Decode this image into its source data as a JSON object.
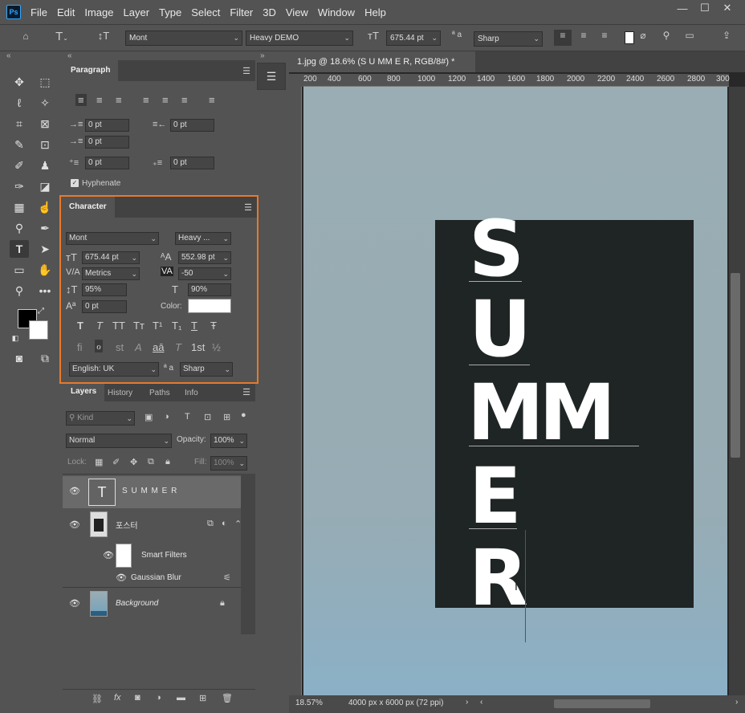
{
  "app": {
    "logo": "Ps"
  },
  "menu": [
    "File",
    "Edit",
    "Image",
    "Layer",
    "Type",
    "Select",
    "Filter",
    "3D",
    "View",
    "Window",
    "Help"
  ],
  "window_controls": [
    "—",
    "☐",
    "✕"
  ],
  "options": {
    "font_family": "Mont",
    "font_style": "Heavy DEMO",
    "font_size": "675.44 pt",
    "antialias_icon": "ª a",
    "antialias": "Sharp"
  },
  "paragraph": {
    "tab": "Paragraph",
    "indent_left": "0 pt",
    "indent_right": "0 pt",
    "indent_first": "0 pt",
    "space_before": "0 pt",
    "space_after": "0 pt",
    "hyphenate": "Hyphenate"
  },
  "character": {
    "tab": "Character",
    "font_family": "Mont",
    "font_style": "Heavy ...",
    "size": "675.44 pt",
    "leading": "552.98 pt",
    "kerning": "Metrics",
    "tracking": "-50",
    "vscale": "95%",
    "hscale": "90%",
    "baseline": "0 pt",
    "color_label": "Color:",
    "language": "English: UK",
    "aa_label": "ª a",
    "antialias": "Sharp",
    "styles": [
      "T",
      "T",
      "TT",
      "Tт",
      "T¹",
      "T₁",
      "T",
      "Ŧ"
    ],
    "otypes": [
      "fi",
      "ℴ",
      "st",
      "A",
      "aā",
      "T",
      "1st",
      "½"
    ]
  },
  "layers": {
    "tabs": [
      "Layers",
      "History",
      "Paths",
      "Info"
    ],
    "filter_kind": "Kind",
    "blend_mode": "Normal",
    "opacity_label": "Opacity:",
    "opacity": "100%",
    "lock_label": "Lock:",
    "fill_label": "Fill:",
    "fill": "100%",
    "items": [
      {
        "name": "S U M M E R"
      },
      {
        "name": "포스터"
      },
      {
        "name": "Smart Filters"
      },
      {
        "name": "Gaussian Blur"
      },
      {
        "name": "Background"
      }
    ]
  },
  "document": {
    "tab": "1.jpg @ 18.6% (S U MM E R, RGB/8#) *",
    "ruler_top": [
      "200",
      "400",
      "600",
      "800",
      "1000",
      "1200",
      "1400",
      "1600",
      "1800",
      "2000",
      "2200",
      "2400",
      "2600",
      "2800",
      "300"
    ],
    "letters": [
      "S",
      "U",
      "MM",
      "E",
      "R"
    ]
  },
  "status": {
    "zoom": "18.57%",
    "size": "4000 px x 6000 px (72 ppi)"
  },
  "colors": {
    "accent": "#e8792b",
    "poster": "#1f2424",
    "bg_top": "#9aadb4"
  }
}
